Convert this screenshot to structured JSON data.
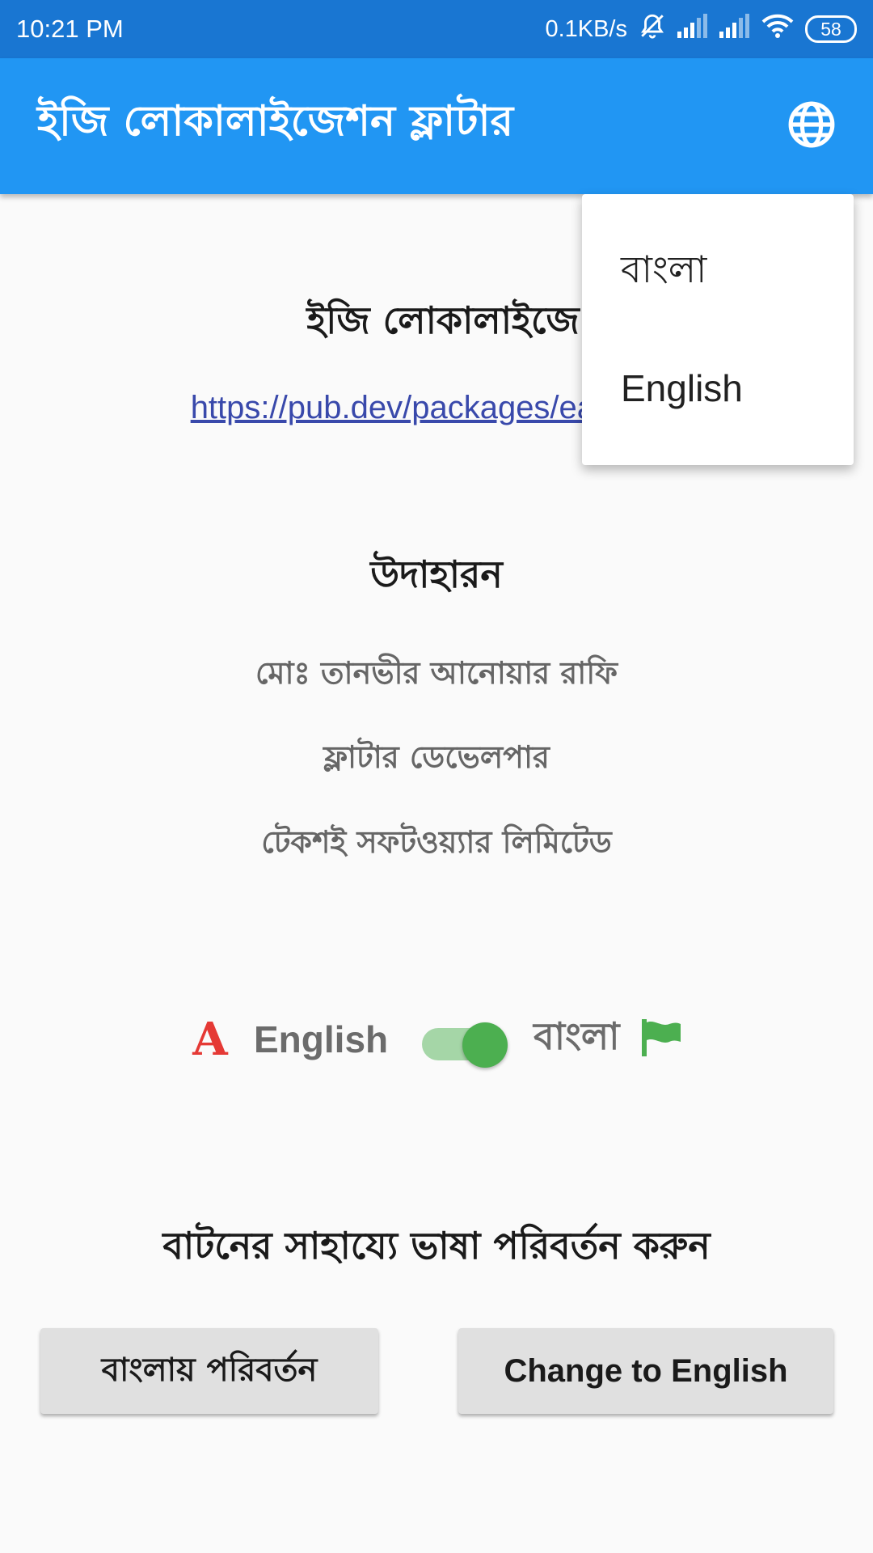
{
  "status_bar": {
    "time": "10:21 PM",
    "network_speed": "0.1KB/s",
    "battery": "58",
    "icons": [
      "mute-icon",
      "signal-icon",
      "signal-icon",
      "wifi-icon",
      "battery-icon"
    ]
  },
  "app_bar": {
    "title": "ইজি লোকালাইজেশন ফ্লাটার",
    "language_icon": "globe-icon",
    "color": "#2196f3"
  },
  "main": {
    "heading": "ইজি লোকালাইজে",
    "link": "https://pub.dev/packages/easy_",
    "example_heading": "উদাহারন",
    "example_lines": [
      "মোঃ তানভীর আনোয়ার রাফি",
      "ফ্লাটার ডেভেলপার",
      "টেকশই সফটওয়্যার লিমিটেড"
    ]
  },
  "toggle": {
    "left_icon": "font-icon",
    "left_label": "English",
    "right_label": "বাংলা",
    "right_icon": "flag-icon",
    "state": "on",
    "accent_color": "#4caf50"
  },
  "button_section": {
    "heading": "বাটনের সাহায্যে ভাষা পরিবর্তন করুন",
    "bangla_button": "বাংলায় পরিবর্তন",
    "english_button": "Change to English"
  },
  "language_menu": {
    "items": [
      "বাংলা",
      "English"
    ]
  }
}
